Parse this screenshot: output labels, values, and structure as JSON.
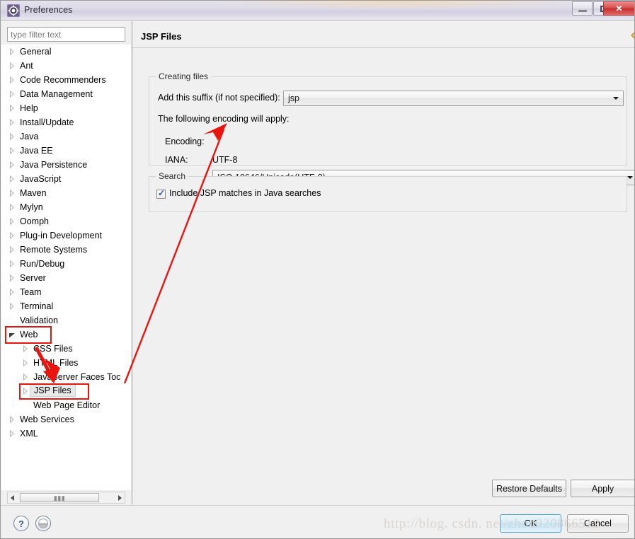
{
  "window": {
    "title": "Preferences",
    "icon": "gear-icon",
    "controls": {
      "minimize": "minimize-icon",
      "maximize": "restore-icon",
      "close": "close-icon"
    }
  },
  "filter": {
    "placeholder": "type filter text",
    "value": ""
  },
  "tree": {
    "items": [
      {
        "label": "General",
        "indent": 0,
        "state": "collapsed"
      },
      {
        "label": "Ant",
        "indent": 0,
        "state": "collapsed"
      },
      {
        "label": "Code Recommenders",
        "indent": 0,
        "state": "collapsed"
      },
      {
        "label": "Data Management",
        "indent": 0,
        "state": "collapsed"
      },
      {
        "label": "Help",
        "indent": 0,
        "state": "collapsed"
      },
      {
        "label": "Install/Update",
        "indent": 0,
        "state": "collapsed"
      },
      {
        "label": "Java",
        "indent": 0,
        "state": "collapsed"
      },
      {
        "label": "Java EE",
        "indent": 0,
        "state": "collapsed"
      },
      {
        "label": "Java Persistence",
        "indent": 0,
        "state": "collapsed"
      },
      {
        "label": "JavaScript",
        "indent": 0,
        "state": "collapsed"
      },
      {
        "label": "Maven",
        "indent": 0,
        "state": "collapsed"
      },
      {
        "label": "Mylyn",
        "indent": 0,
        "state": "collapsed"
      },
      {
        "label": "Oomph",
        "indent": 0,
        "state": "collapsed"
      },
      {
        "label": "Plug-in Development",
        "indent": 0,
        "state": "collapsed"
      },
      {
        "label": "Remote Systems",
        "indent": 0,
        "state": "collapsed"
      },
      {
        "label": "Run/Debug",
        "indent": 0,
        "state": "collapsed"
      },
      {
        "label": "Server",
        "indent": 0,
        "state": "collapsed"
      },
      {
        "label": "Team",
        "indent": 0,
        "state": "collapsed"
      },
      {
        "label": "Terminal",
        "indent": 0,
        "state": "collapsed"
      },
      {
        "label": "Validation",
        "indent": 0,
        "state": "leaf"
      },
      {
        "label": "Web",
        "indent": 0,
        "state": "expanded"
      },
      {
        "label": "CSS Files",
        "indent": 1,
        "state": "collapsed"
      },
      {
        "label": "HTML Files",
        "indent": 1,
        "state": "collapsed"
      },
      {
        "label": "JavaServer Faces Toc",
        "indent": 1,
        "state": "collapsed"
      },
      {
        "label": "JSP Files",
        "indent": 1,
        "state": "collapsed",
        "selected": true
      },
      {
        "label": "Web Page Editor",
        "indent": 1,
        "state": "leaf"
      },
      {
        "label": "Web Services",
        "indent": 0,
        "state": "collapsed"
      },
      {
        "label": "XML",
        "indent": 0,
        "state": "collapsed"
      }
    ]
  },
  "page": {
    "title": "JSP Files",
    "nav": {
      "back": "back-arrow-icon",
      "back_menu": "chevron-down-icon",
      "forward": "forward-arrow-icon",
      "forward_menu": "chevron-down-icon",
      "view_menu": "chevron-down-icon"
    },
    "creating_files": {
      "group_title": "Creating files",
      "suffix_label": "Add this suffix (if not specified):",
      "suffix_value": "jsp",
      "encoding_note": "The following encoding will apply:",
      "encoding_label": "Encoding:",
      "encoding_value": "ISO 10646/Unicode(UTF-8)",
      "iana_label": "IANA:",
      "iana_value": "UTF-8"
    },
    "search": {
      "group_title": "Search",
      "checkbox_label": "Include JSP matches in Java searches",
      "checkbox_checked": true
    },
    "buttons": {
      "restore_defaults": "Restore Defaults",
      "apply": "Apply"
    }
  },
  "footer": {
    "help_icon": "question-mark-icon",
    "secondary_icon": "circle-icon",
    "ok": "OK",
    "cancel": "Cancel"
  },
  "watermark": {
    "text": "http://blog. csdn. net/zhou920866512"
  },
  "annotations": {
    "highlight_color": "#e8150f",
    "boxes": [
      "Web",
      "JSP Files"
    ],
    "arrows": [
      "points-to-jsp-files",
      "points-to-encoding-combo"
    ]
  }
}
